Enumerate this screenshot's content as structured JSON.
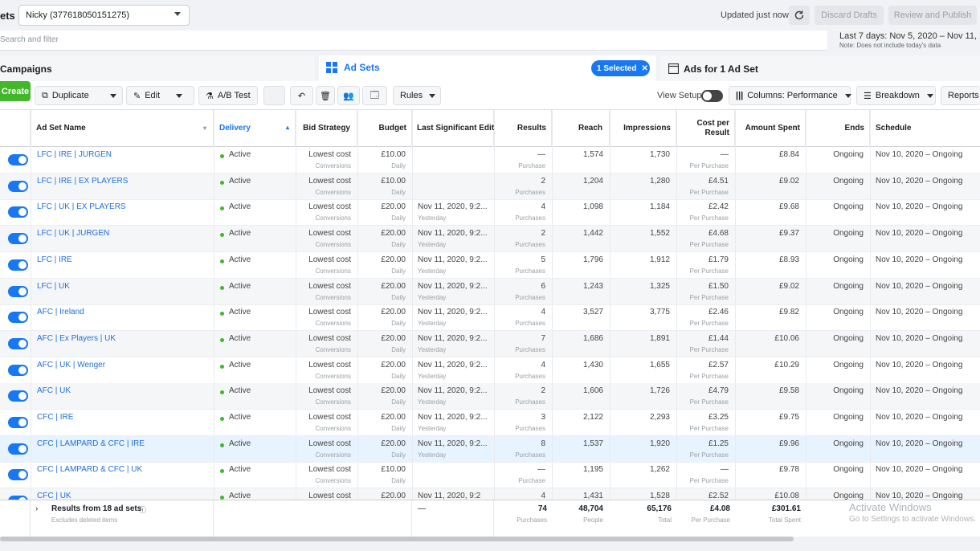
{
  "header": {
    "title_fragment": "ets",
    "account": "Nicky (377618050151275)",
    "updated": "Updated just now",
    "discard_label": "Discard Drafts",
    "review_label": "Review and Publish"
  },
  "search": {
    "placeholder": "Search and filter"
  },
  "date_range": {
    "label": "Last 7 days: Nov 5, 2020 – Nov 11, 2020",
    "note": "Note: Does not include today's data"
  },
  "tabs": {
    "campaigns": "Campaigns",
    "ad_sets": "Ad Sets",
    "selected": "1 Selected",
    "ads": "Ads for 1 Ad Set"
  },
  "toolbar": {
    "create": "Create",
    "duplicate": "Duplicate",
    "edit": "Edit",
    "ab_test": "A/B Test",
    "rules": "Rules",
    "view_setup": "View Setup",
    "columns": "Columns: Performance",
    "breakdown": "Breakdown",
    "reports": "Reports"
  },
  "columns": {
    "name": "Ad Set Name",
    "delivery": "Delivery",
    "bid": "Bid Strategy",
    "budget": "Budget",
    "last_edit": "Last Significant Edit",
    "results": "Results",
    "reach": "Reach",
    "impressions": "Impressions",
    "cpr_line1": "Cost per",
    "cpr_line2": "Result",
    "spent": "Amount Spent",
    "ends": "Ends",
    "schedule": "Schedule"
  },
  "rows": [
    {
      "name": "LFC | IRE | JURGEN",
      "delivery": "Active",
      "bid": "Lowest cost",
      "bid_sub": "Conversions",
      "budget": "£10.00",
      "budget_sub": "Daily",
      "edit": "",
      "edit_sub": "",
      "results": "—",
      "results_sub": "Purchase",
      "reach": "1,574",
      "impressions": "1,730",
      "cpr": "—",
      "cpr_sub": "Per Purchase",
      "spent": "£8.84",
      "ends": "Ongoing",
      "schedule": "Nov 10, 2020 – Ongoing"
    },
    {
      "name": "LFC | IRE | EX PLAYERS",
      "delivery": "Active",
      "bid": "Lowest cost",
      "bid_sub": "Conversions",
      "budget": "£10.00",
      "budget_sub": "Daily",
      "edit": "",
      "edit_sub": "",
      "results": "2",
      "results_sub": "Purchases",
      "reach": "1,204",
      "impressions": "1,280",
      "cpr": "£4.51",
      "cpr_sub": "Per Purchase",
      "spent": "£9.02",
      "ends": "Ongoing",
      "schedule": "Nov 10, 2020 – Ongoing"
    },
    {
      "name": "LFC | UK | EX PLAYERS",
      "delivery": "Active",
      "bid": "Lowest cost",
      "bid_sub": "Conversions",
      "budget": "£20.00",
      "budget_sub": "Daily",
      "edit": "Nov 11, 2020, 9:2...",
      "edit_sub": "Yesterday",
      "results": "4",
      "results_sub": "Purchases",
      "reach": "1,098",
      "impressions": "1,184",
      "cpr": "£2.42",
      "cpr_sub": "Per Purchase",
      "spent": "£9.68",
      "ends": "Ongoing",
      "schedule": "Nov 10, 2020 – Ongoing"
    },
    {
      "name": "LFC | UK | JURGEN",
      "delivery": "Active",
      "bid": "Lowest cost",
      "bid_sub": "Conversions",
      "budget": "£20.00",
      "budget_sub": "Daily",
      "edit": "Nov 11, 2020, 9:2...",
      "edit_sub": "Yesterday",
      "results": "2",
      "results_sub": "Purchases",
      "reach": "1,442",
      "impressions": "1,552",
      "cpr": "£4.68",
      "cpr_sub": "Per Purchase",
      "spent": "£9.37",
      "ends": "Ongoing",
      "schedule": "Nov 10, 2020 – Ongoing"
    },
    {
      "name": "LFC | IRE",
      "delivery": "Active",
      "bid": "Lowest cost",
      "bid_sub": "Conversions",
      "budget": "£20.00",
      "budget_sub": "Daily",
      "edit": "Nov 11, 2020, 9:2...",
      "edit_sub": "Yesterday",
      "results": "5",
      "results_sub": "Purchases",
      "reach": "1,796",
      "impressions": "1,912",
      "cpr": "£1.79",
      "cpr_sub": "Per Purchase",
      "spent": "£8.93",
      "ends": "Ongoing",
      "schedule": "Nov 10, 2020 – Ongoing"
    },
    {
      "name": "LFC | UK",
      "delivery": "Active",
      "bid": "Lowest cost",
      "bid_sub": "Conversions",
      "budget": "£20.00",
      "budget_sub": "Daily",
      "edit": "Nov 11, 2020, 9:2...",
      "edit_sub": "Yesterday",
      "results": "6",
      "results_sub": "Purchases",
      "reach": "1,243",
      "impressions": "1,325",
      "cpr": "£1.50",
      "cpr_sub": "Per Purchase",
      "spent": "£9.02",
      "ends": "Ongoing",
      "schedule": "Nov 10, 2020 – Ongoing"
    },
    {
      "name": "AFC | Ireland",
      "delivery": "Active",
      "bid": "Lowest cost",
      "bid_sub": "Conversions",
      "budget": "£20.00",
      "budget_sub": "Daily",
      "edit": "Nov 11, 2020, 9:2...",
      "edit_sub": "Yesterday",
      "results": "4",
      "results_sub": "Purchases",
      "reach": "3,527",
      "impressions": "3,775",
      "cpr": "£2.46",
      "cpr_sub": "Per Purchase",
      "spent": "£9.82",
      "ends": "Ongoing",
      "schedule": "Nov 10, 2020 – Ongoing"
    },
    {
      "name": "AFC | Ex Players | UK",
      "delivery": "Active",
      "bid": "Lowest cost",
      "bid_sub": "Conversions",
      "budget": "£20.00",
      "budget_sub": "Daily",
      "edit": "Nov 11, 2020, 9:2...",
      "edit_sub": "Yesterday",
      "results": "7",
      "results_sub": "Purchases",
      "reach": "1,686",
      "impressions": "1,891",
      "cpr": "£1.44",
      "cpr_sub": "Per Purchase",
      "spent": "£10.06",
      "ends": "Ongoing",
      "schedule": "Nov 10, 2020 – Ongoing"
    },
    {
      "name": "AFC | UK | Wenger",
      "delivery": "Active",
      "bid": "Lowest cost",
      "bid_sub": "Conversions",
      "budget": "£20.00",
      "budget_sub": "Daily",
      "edit": "Nov 11, 2020, 9:2...",
      "edit_sub": "Yesterday",
      "results": "4",
      "results_sub": "Purchases",
      "reach": "1,430",
      "impressions": "1,655",
      "cpr": "£2.57",
      "cpr_sub": "Per Purchase",
      "spent": "£10.29",
      "ends": "Ongoing",
      "schedule": "Nov 10, 2020 – Ongoing"
    },
    {
      "name": "AFC | UK",
      "delivery": "Active",
      "bid": "Lowest cost",
      "bid_sub": "Conversions",
      "budget": "£20.00",
      "budget_sub": "Daily",
      "edit": "Nov 11, 2020, 9:2...",
      "edit_sub": "Yesterday",
      "results": "2",
      "results_sub": "Purchases",
      "reach": "1,606",
      "impressions": "1,726",
      "cpr": "£4.79",
      "cpr_sub": "Per Purchase",
      "spent": "£9.58",
      "ends": "Ongoing",
      "schedule": "Nov 10, 2020 – Ongoing"
    },
    {
      "name": "CFC | IRE",
      "delivery": "Active",
      "bid": "Lowest cost",
      "bid_sub": "Conversions",
      "budget": "£20.00",
      "budget_sub": "Daily",
      "edit": "Nov 11, 2020, 9:2...",
      "edit_sub": "Yesterday",
      "results": "3",
      "results_sub": "Purchases",
      "reach": "2,122",
      "impressions": "2,293",
      "cpr": "£3.25",
      "cpr_sub": "Per Purchase",
      "spent": "£9.75",
      "ends": "Ongoing",
      "schedule": "Nov 10, 2020 – Ongoing"
    },
    {
      "name": "CFC | LAMPARD & CFC | IRE",
      "delivery": "Active",
      "bid": "Lowest cost",
      "bid_sub": "Conversions",
      "budget": "£20.00",
      "budget_sub": "Daily",
      "edit": "Nov 11, 2020, 9:2...",
      "edit_sub": "Yesterday",
      "results": "8",
      "results_sub": "Purchases",
      "reach": "1,537",
      "impressions": "1,920",
      "cpr": "£1.25",
      "cpr_sub": "Per Purchase",
      "spent": "£9.96",
      "ends": "Ongoing",
      "schedule": "Nov 10, 2020 – Ongoing"
    },
    {
      "name": "CFC | LAMPARD & CFC | UK",
      "delivery": "Active",
      "bid": "Lowest cost",
      "bid_sub": "Conversions",
      "budget": "£10.00",
      "budget_sub": "Daily",
      "edit": "",
      "edit_sub": "",
      "results": "—",
      "results_sub": "Purchase",
      "reach": "1,195",
      "impressions": "1,262",
      "cpr": "—",
      "cpr_sub": "Per Purchase",
      "spent": "£9.78",
      "ends": "Ongoing",
      "schedule": "Nov 10, 2020 – Ongoing"
    },
    {
      "name": "CFC | UK",
      "delivery": "Active",
      "bid": "Lowest cost",
      "bid_sub": "",
      "budget": "£20.00",
      "budget_sub": "",
      "edit": "Nov 11, 2020, 9:2",
      "edit_sub": "",
      "results": "4",
      "results_sub": "",
      "reach": "1,431",
      "impressions": "1,528",
      "cpr": "£2.52",
      "cpr_sub": "",
      "spent": "£10.08",
      "ends": "Ongoing",
      "schedule": "Nov 10, 2020 – Ongoing"
    }
  ],
  "footer": {
    "label": "Results from 18 ad sets",
    "sub": "Excludes deleted items",
    "last_edit": "—",
    "results": "74",
    "results_sub": "Purchases",
    "reach": "48,704",
    "reach_sub": "People",
    "impressions": "65,176",
    "impressions_sub": "Total",
    "cpr": "£4.08",
    "cpr_sub": "Per Purchase",
    "spent": "£301.61",
    "spent_sub": "Total Spent"
  },
  "watermark": {
    "line1": "Activate Windows",
    "line2": "Go to Settings to activate Windows."
  },
  "colors": {
    "brand": "#1877f2",
    "create": "#42b72a",
    "active_dot": "#42b72a",
    "link": "#216fdb"
  }
}
